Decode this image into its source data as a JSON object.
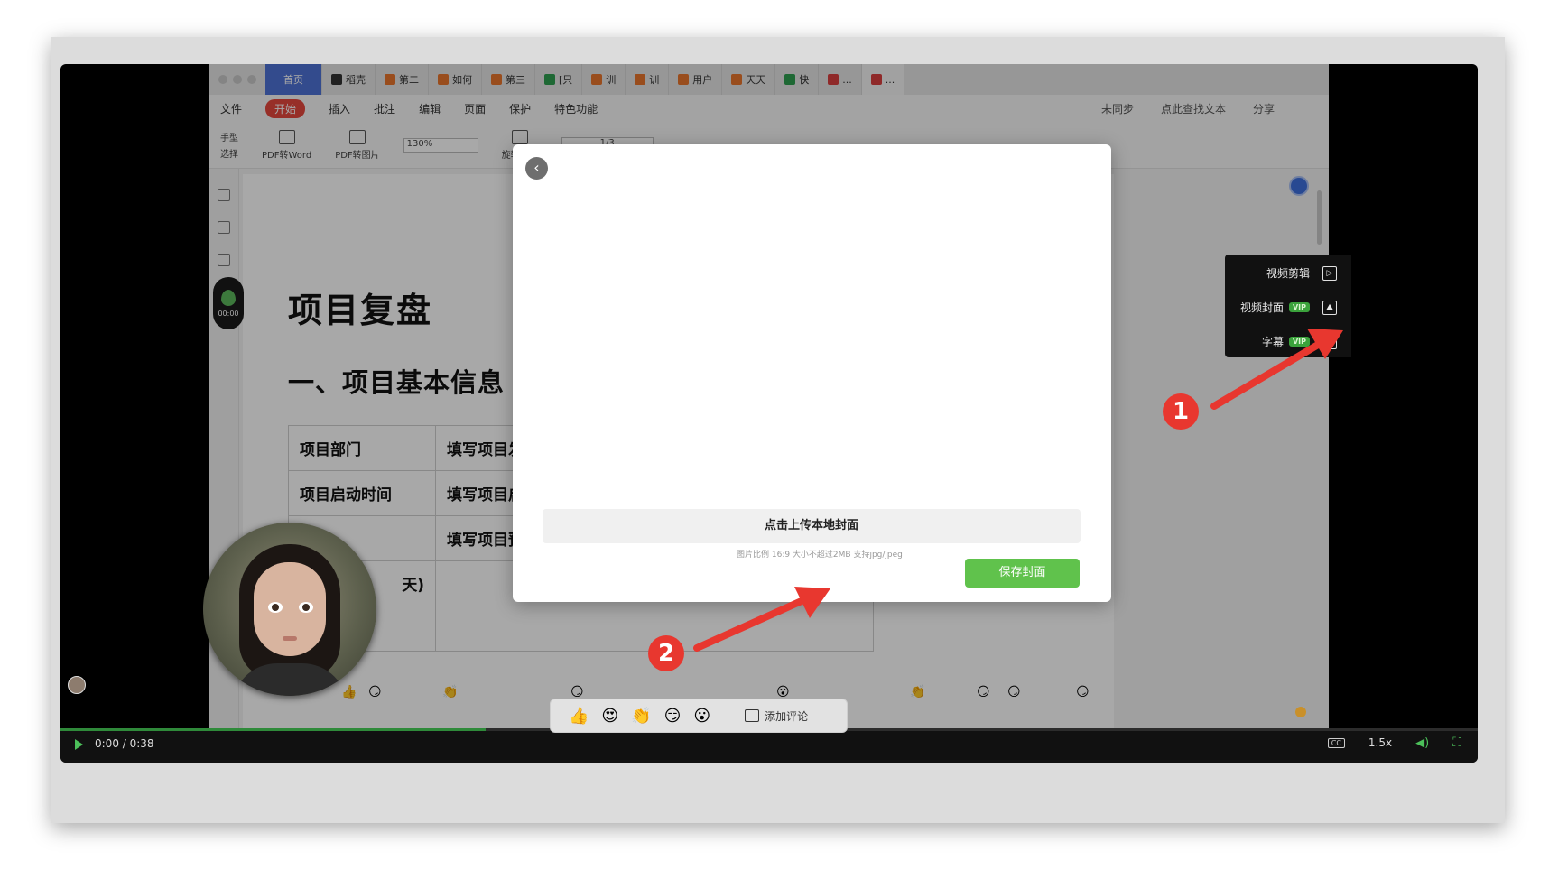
{
  "wps": {
    "tabs": [
      {
        "label": "首页",
        "color": "#4e73d6",
        "kind": "home"
      },
      {
        "label": "稻壳",
        "color": "#333333",
        "kind": "normal"
      },
      {
        "label": "第二",
        "color": "#e8762c",
        "kind": "normal"
      },
      {
        "label": "如何",
        "color": "#e8762c",
        "kind": "normal"
      },
      {
        "label": "第三",
        "color": "#e8762c",
        "kind": "normal"
      },
      {
        "label": "[只",
        "color": "#2e9e4f",
        "kind": "normal"
      },
      {
        "label": "训",
        "color": "#e8762c",
        "kind": "normal"
      },
      {
        "label": "训",
        "color": "#e8762c",
        "kind": "normal"
      },
      {
        "label": "用户",
        "color": "#e8762c",
        "kind": "normal"
      },
      {
        "label": "天天",
        "color": "#e8762c",
        "kind": "normal"
      },
      {
        "label": "快",
        "color": "#2e9e4f",
        "kind": "normal"
      },
      {
        "label": "...",
        "color": "#d93f3f",
        "kind": "normal"
      },
      {
        "label": "...",
        "color": "#d93f3f",
        "kind": "active"
      }
    ],
    "menu": {
      "file": "文件",
      "start": "开始",
      "items": [
        "插入",
        "批注",
        "编辑",
        "页面",
        "保护",
        "特色功能"
      ],
      "right": [
        "未同步",
        "点此查找文本",
        "分享"
      ]
    },
    "toolbar": {
      "hand": "手型",
      "select": "选择",
      "pdf_word": "PDF转Word",
      "pdf_img": "PDF转图片",
      "zoom": "130%",
      "page": "1/3",
      "rotate": "旋转文档"
    }
  },
  "doc": {
    "title": "项目复盘",
    "section": "一、项目基本信息",
    "rows": [
      [
        "项目部门",
        "填写项目发起"
      ],
      [
        "项目启动时间",
        "填写项目启动"
      ],
      [
        "",
        "填写项目预算"
      ],
      [
        "天)",
        ""
      ],
      [
        "",
        ""
      ]
    ]
  },
  "recorder": {
    "time": "00:00"
  },
  "modal": {
    "back_icon": "‹",
    "upload_label": "点击上传本地封面",
    "upload_hint": "图片比例 16:9 大小不超过2MB 支持jpg/jpeg",
    "save_label": "保存封面"
  },
  "side_panel": {
    "video_edit": "视频剪辑",
    "video_cover": "视频封面",
    "subtitles": "字幕",
    "vip": "VIP"
  },
  "player": {
    "time": "0:00 / 0:38",
    "speed": "1.5x",
    "progress": 0.3
  },
  "bottom_bar": {
    "emojis": [
      "👍",
      "😍",
      "👏",
      "😏",
      "😮"
    ],
    "comment": "添加评论"
  },
  "annotations": {
    "one": "1",
    "two": "2",
    "color": "#e8372f"
  }
}
